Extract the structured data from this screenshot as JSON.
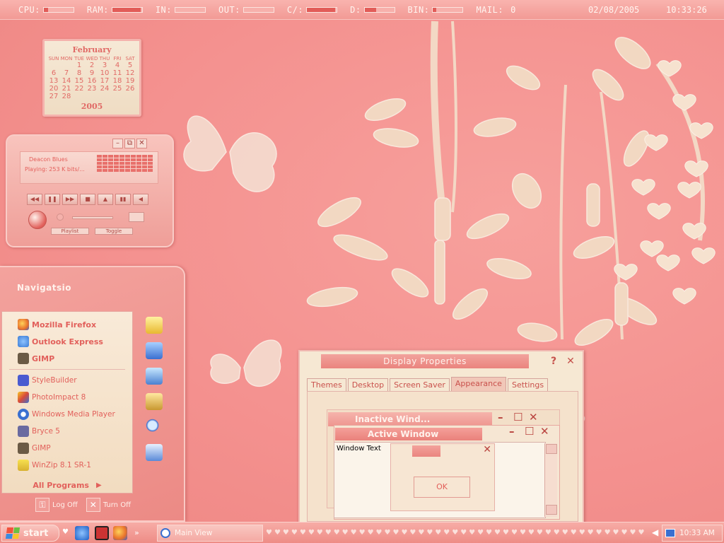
{
  "statusbar": {
    "items": [
      {
        "label": "CPU:",
        "fill": 0.15
      },
      {
        "label": "RAM:",
        "fill": 0.95
      },
      {
        "label": "IN:",
        "fill": 0.0
      },
      {
        "label": "OUT:",
        "fill": 0.0
      },
      {
        "label": "C/:",
        "fill": 0.95
      },
      {
        "label": "D:",
        "fill": 0.4
      },
      {
        "label": "BIN:",
        "fill": 0.1
      }
    ],
    "mail_label": "MAIL:",
    "mail_count": "0",
    "date": "02/08/2005",
    "time": "10:33:26"
  },
  "calendar": {
    "month": "February",
    "year": "2005",
    "weekdays": [
      "SUN",
      "MON",
      "TUE",
      "WED",
      "THU",
      "FRI",
      "SAT"
    ],
    "days": [
      "",
      "",
      "1",
      "2",
      "3",
      "4",
      "5",
      "6",
      "7",
      "8",
      "9",
      "10",
      "11",
      "12",
      "13",
      "14",
      "15",
      "16",
      "17",
      "18",
      "19",
      "20",
      "21",
      "22",
      "23",
      "24",
      "25",
      "26",
      "27",
      "28"
    ]
  },
  "player": {
    "track": "Deacon Blues",
    "status": "Playing: 253 K bits/...",
    "controls": [
      "◀◀",
      "❚❚",
      "▶▶",
      "■",
      "▲",
      "▮▮",
      "◀"
    ],
    "tabs": [
      "Playlist",
      "Toggle"
    ]
  },
  "startmenu": {
    "header": "Navigatsio",
    "pinned": [
      {
        "label": "Mozilla Firefox",
        "icon": "firefox-icon",
        "color": "#e8702a"
      },
      {
        "label": "Outlook Express",
        "icon": "outlook-icon",
        "color": "#3a7bd5"
      },
      {
        "label": "GIMP",
        "icon": "gimp-icon",
        "color": "#6b5a45"
      }
    ],
    "recent": [
      {
        "label": "StyleBuilder",
        "icon": "stylebuilder-icon",
        "color": "#4a5bd0"
      },
      {
        "label": "PhotoImpact 8",
        "icon": "photoimpact-icon",
        "color": "#d84a3a"
      },
      {
        "label": "Windows Media Player",
        "icon": "media-player-icon",
        "color": "#3a6fd0"
      },
      {
        "label": "Bryce 5",
        "icon": "bryce-icon",
        "color": "#6a6aa0"
      },
      {
        "label": "GIMP",
        "icon": "gimp-icon",
        "color": "#6b5a45"
      },
      {
        "label": "WinZip 8.1 SR-1",
        "icon": "winzip-icon",
        "color": "#d8b030"
      }
    ],
    "all_programs": "All Programs",
    "right_icons": [
      "my-documents-icon",
      "my-computer-icon",
      "control-panel-icon",
      "printers-icon",
      "search-icon",
      "run-icon"
    ],
    "log_off": "Log Off",
    "turn_off": "Turn Off"
  },
  "dialog": {
    "title": "Display Properties",
    "tabs": [
      "Themes",
      "Desktop",
      "Screen Saver",
      "Appearance",
      "Settings"
    ],
    "active_tab": "Appearance",
    "inactive_window": "Inactive Wind...",
    "active_window": "Active Window",
    "window_text": "Window Text",
    "ok": "OK"
  },
  "taskbar": {
    "start": "start",
    "quicklaunch": [
      "ie-icon",
      "game-icon",
      "firefox-icon"
    ],
    "task": "Main View",
    "clock": "10:33 AM"
  }
}
